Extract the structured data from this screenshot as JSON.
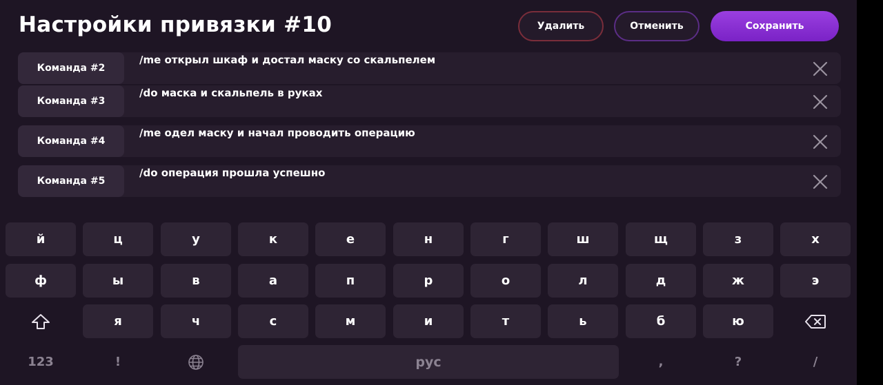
{
  "header": {
    "title": "Настройки привязки #10",
    "delete_label": "Удалить",
    "cancel_label": "Отменить",
    "save_label": "Сохранить"
  },
  "commands": [
    {
      "label": "Команда #2",
      "text": "/me открыл шкаф и достал маску со скальпелем"
    },
    {
      "label": "Команда #3",
      "text": "/do маска и скальпель в руках"
    },
    {
      "label": "Команда #4",
      "text": "/me одел маску и начал проводить операцию"
    },
    {
      "label": "Команда #5",
      "text": "/do операция прошла успешно"
    }
  ],
  "keyboard": {
    "row1": [
      "й",
      "ц",
      "у",
      "к",
      "е",
      "н",
      "г",
      "ш",
      "щ",
      "з",
      "х"
    ],
    "row2": [
      "ф",
      "ы",
      "в",
      "а",
      "п",
      "р",
      "о",
      "л",
      "д",
      "ж",
      "э"
    ],
    "row3": [
      "я",
      "ч",
      "с",
      "м",
      "и",
      "т",
      "ь",
      "б",
      "ю"
    ],
    "row4": {
      "numbers": "123",
      "exclaim": "!",
      "space": "рус",
      "comma": ",",
      "question": "?",
      "slash": "/"
    },
    "icons": {
      "shift": "shift-icon",
      "backspace": "backspace-icon",
      "globe": "globe-icon"
    }
  },
  "colors": {
    "background": "#1e1524",
    "accent": "#8a2fd6",
    "delete_border": "#7a2d3a",
    "cancel_border": "#5b2d86"
  }
}
